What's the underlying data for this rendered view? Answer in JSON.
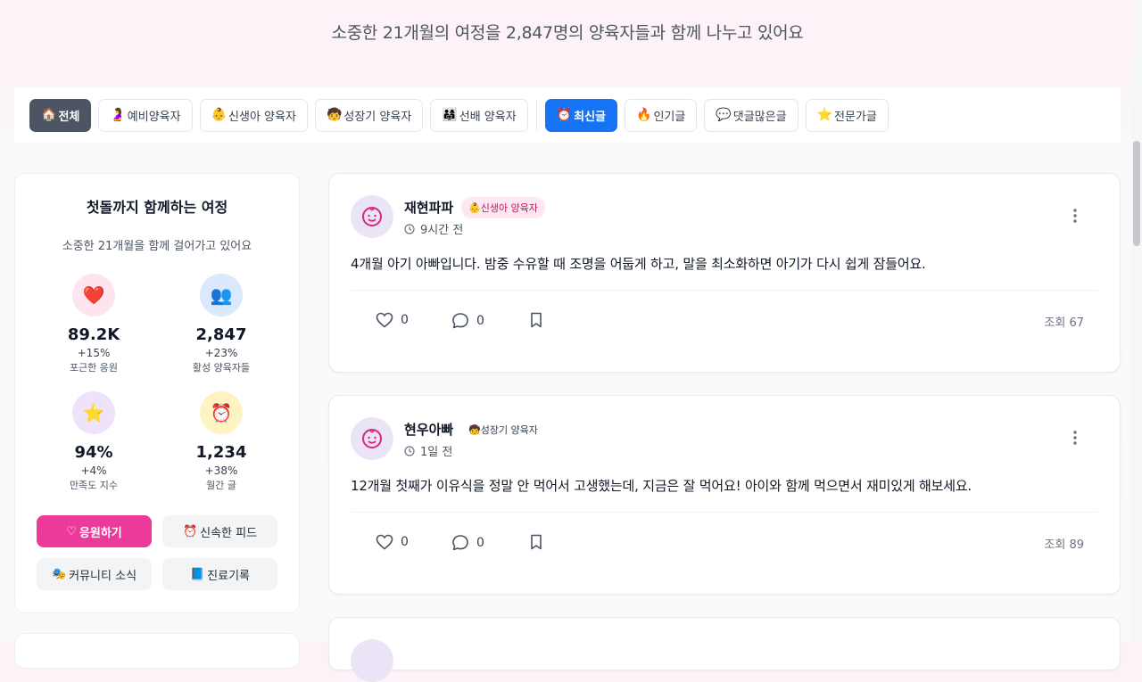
{
  "header": {
    "headline": "소중한 21개월의 여정을 2,847명의 양육자들과 함께 나누고 있어요"
  },
  "filters": {
    "categories": [
      {
        "emoji": "🏠",
        "label": "전체",
        "active": true
      },
      {
        "emoji": "🤰",
        "label": "예비양육자"
      },
      {
        "emoji": "👶",
        "label": "신생아 양육자"
      },
      {
        "emoji": "🧒",
        "label": "성장기 양육자"
      },
      {
        "emoji": "👨‍👩‍👧",
        "label": "선배 양육자"
      }
    ],
    "sorts": [
      {
        "emoji": "⏰",
        "label": "최신글",
        "active": true
      },
      {
        "emoji": "🔥",
        "label": "인기글"
      },
      {
        "emoji": "💬",
        "label": "댓글많은글"
      },
      {
        "emoji": "⭐",
        "label": "전문가글"
      }
    ]
  },
  "sidebar": {
    "title": "첫돌까지 함께하는 여정",
    "subtitle": "소중한 21개월을 함께 걸어가고 있어요",
    "stats": [
      {
        "icon": "❤️",
        "value": "89.2K",
        "delta": "+15%",
        "label": "포근한 응원",
        "bg": "#fde4ef"
      },
      {
        "icon": "👥",
        "value": "2,847",
        "delta": "+23%",
        "label": "활성 양육자들",
        "bg": "#dbe8fd"
      },
      {
        "icon": "⭐",
        "value": "94%",
        "delta": "+4%",
        "label": "만족도 지수",
        "bg": "#efe3fb"
      },
      {
        "icon": "⏰",
        "value": "1,234",
        "delta": "+38%",
        "label": "월간 글",
        "bg": "#fdf3c3"
      }
    ],
    "buttons": [
      {
        "emoji": "♡",
        "label": "응원하기"
      },
      {
        "emoji": "⏰",
        "label": "신속한 피드"
      },
      {
        "emoji": "🎭",
        "label": "커뮤니티 소식"
      },
      {
        "emoji": "📘",
        "label": "진료기록"
      }
    ]
  },
  "posts": [
    {
      "author": "재현파파",
      "badge_emoji": "👶",
      "badge": "신생아 양육자",
      "time": "9시간 전",
      "body": "4개월 아기 아빠입니다. 밤중 수유할 때 조명을 어둡게 하고, 말을 최소화하면 아기가 다시 쉽게 잠들어요.",
      "likes": "0",
      "comments": "0",
      "views": "조회 67"
    },
    {
      "author": "현우아빠",
      "badge_emoji": "🧒",
      "badge": "성장기 양육자",
      "time": "1일 전",
      "body": "12개월 첫째가 이유식을 정말 안 먹어서 고생했는데, 지금은 잘 먹어요! 아이와 함께 먹으면서 재미있게 해보세요.",
      "likes": "0",
      "comments": "0",
      "views": "조회 89"
    }
  ],
  "colors": {
    "brand_pink": "#ec3a9b",
    "active_blue": "#1573f5",
    "active_dark": "#4b5563"
  }
}
